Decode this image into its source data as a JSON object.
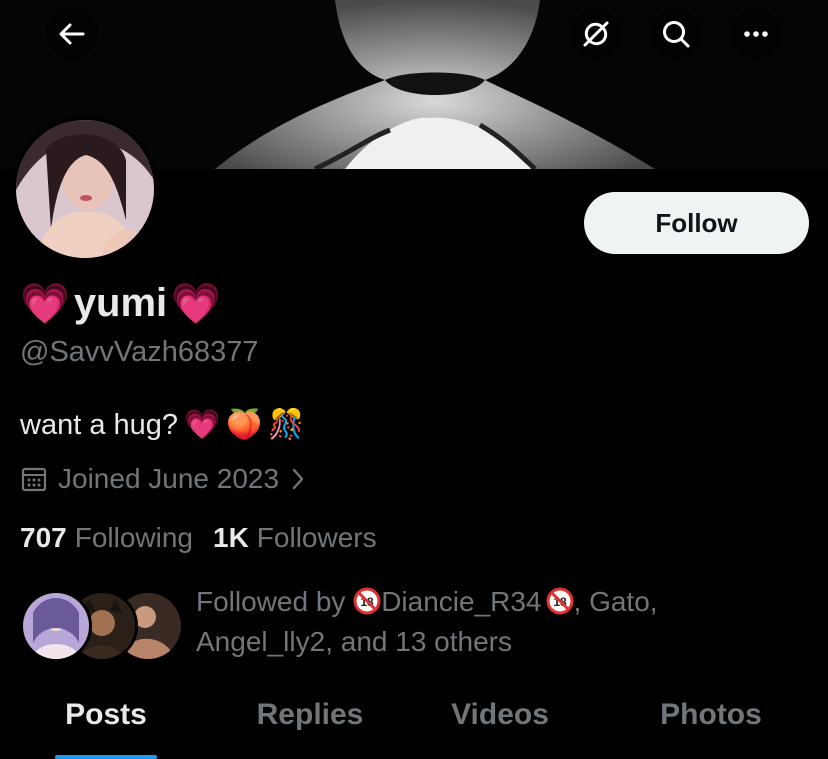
{
  "header": {
    "back_icon": "arrow-left-icon",
    "icons": [
      "no-sync-icon",
      "search-icon",
      "more-icon"
    ]
  },
  "profile": {
    "display_name": "yumi",
    "name_emoji": "💗",
    "handle": "@SavvVazh68377",
    "bio_text": "want a hug?",
    "bio_emojis": [
      "💗",
      "🍑",
      "🎊"
    ],
    "joined": "Joined June 2023",
    "following_count": "707",
    "following_label": "Following",
    "followers_count": "1K",
    "followers_label": "Followers"
  },
  "follow_button": {
    "label": "Follow"
  },
  "followed_by": {
    "prefix": "Followed by",
    "name1": "Diancie_R34",
    "separator1": ", Gato,",
    "line2": "Angel_lly2, and 13 others"
  },
  "tabs": [
    {
      "label": "Posts",
      "active": true
    },
    {
      "label": "Replies",
      "active": false
    },
    {
      "label": "Videos",
      "active": false
    },
    {
      "label": "Photos",
      "active": false
    }
  ],
  "colors": {
    "background": "#000000",
    "primary_text": "#e7e9ea",
    "secondary_text": "#71767b",
    "accent": "#1d9bf0",
    "follow_button_bg": "#eff3f4",
    "heart": "#ff4fc8",
    "badge_red": "#e03030"
  }
}
